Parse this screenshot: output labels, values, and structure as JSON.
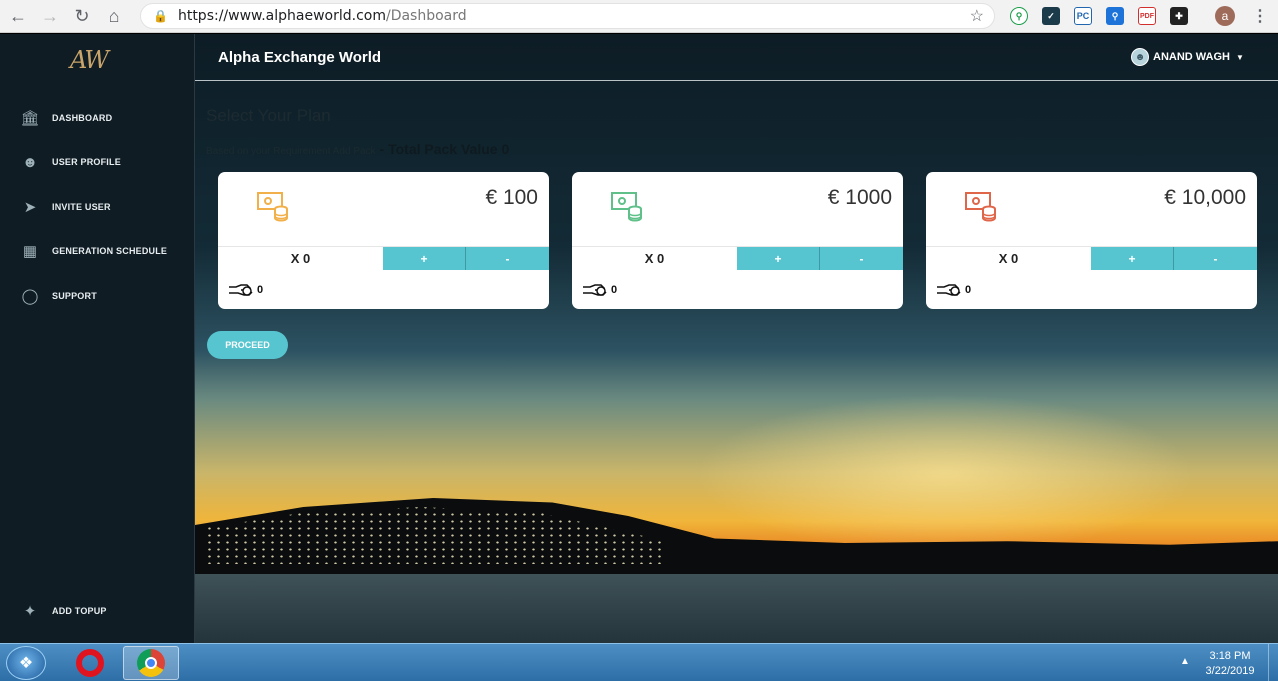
{
  "browser": {
    "url_domain": "https://www.alphaeworld.com",
    "url_path": "/Dashboard",
    "profile_initial": "a"
  },
  "sidebar": {
    "logo": "AW",
    "items": [
      {
        "label": "DASHBOARD",
        "icon": "bank-icon"
      },
      {
        "label": "USER PROFILE",
        "icon": "user-icon"
      },
      {
        "label": "INVITE USER",
        "icon": "send-icon"
      },
      {
        "label": "GENERATION SCHEDULE",
        "icon": "calendar-icon"
      },
      {
        "label": "SUPPORT",
        "icon": "chat-icon"
      }
    ],
    "bottom_item": {
      "label": "ADD TOPUP",
      "icon": "rocket-icon"
    }
  },
  "header": {
    "title": "Alpha Exchange World",
    "user_name": "ANAND WAGH"
  },
  "main": {
    "heading": "Select Your Plan",
    "subheading": "Based on your Requirement Add Pack",
    "total_label": "- Total Pack Value 0",
    "cards": [
      {
        "price": "€ 100",
        "qty": "X 0",
        "plus": "+",
        "minus": "-",
        "value": "0",
        "color": "#f2b04a"
      },
      {
        "price": "€ 1000",
        "qty": "X 0",
        "plus": "+",
        "minus": "-",
        "value": "0",
        "color": "#5fc08a"
      },
      {
        "price": "€ 10,000",
        "qty": "X 0",
        "plus": "+",
        "minus": "-",
        "value": "0",
        "color": "#e0664a"
      }
    ],
    "proceed_label": "PROCEED"
  },
  "taskbar": {
    "time": "3:18 PM",
    "date": "3/22/2019"
  },
  "colors": {
    "accent": "#56c5cf",
    "sidebar_bg": "#0f1c24"
  }
}
